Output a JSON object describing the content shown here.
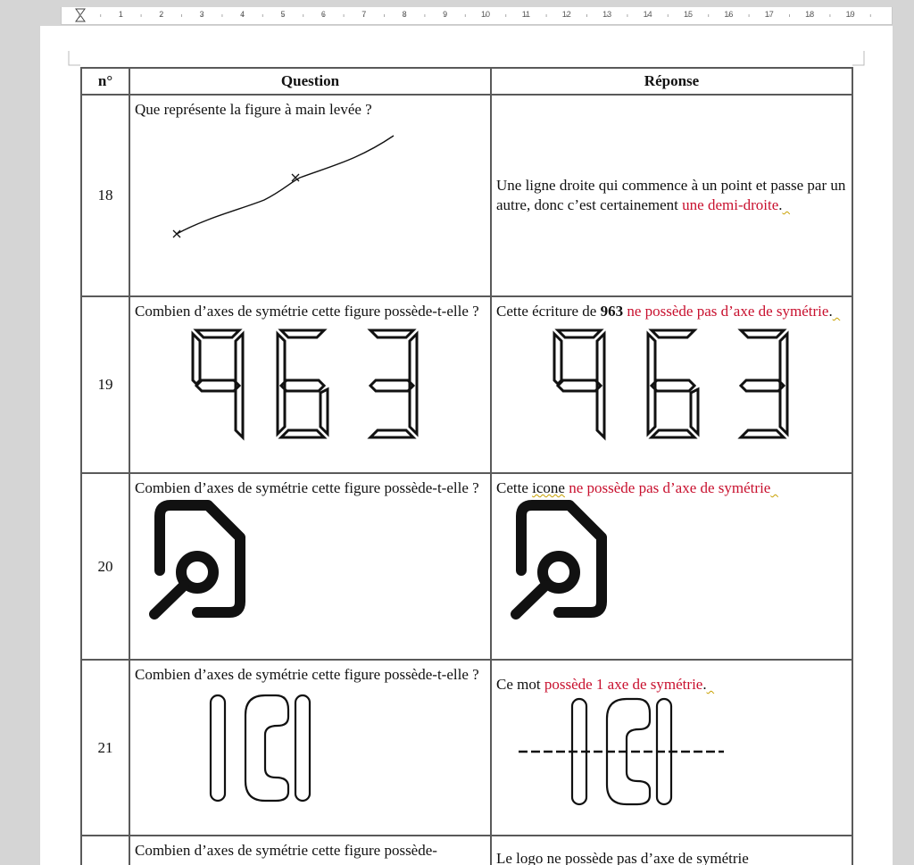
{
  "ruler": {
    "numbers": [
      "1",
      "2",
      "3",
      "4",
      "5",
      "6",
      "7",
      "8",
      "9",
      "10",
      "11",
      "12",
      "13",
      "14",
      "15",
      "16",
      "17",
      "18",
      "19"
    ]
  },
  "table": {
    "headers": {
      "num": "n°",
      "question": "Question",
      "answer": "Réponse"
    },
    "rows": [
      {
        "num": "18",
        "question": "Que représente la figure à main levée ?",
        "answer_plain": "Une ligne droite qui commence à un point et passe par un autre, donc c’est certainement ",
        "answer_red": "une demi-droite",
        "answer_end": "."
      },
      {
        "num": "19",
        "question": "Combien d’axes de symétrie cette figure possède-t-elle ?",
        "answer_plain": "Cette écriture de ",
        "answer_bold": "963",
        "answer_red": " ne possède pas d’axe de symétrie",
        "answer_end": ".",
        "digits": "963"
      },
      {
        "num": "20",
        "question": "Combien d’axes de symétrie cette figure possède-t-elle ?",
        "answer_plain": "Cette ",
        "answer_wavy": "icone",
        "answer_red": " ne possède pas d’axe de symétrie"
      },
      {
        "num": "21",
        "question": "Combien d’axes de symétrie cette figure possède-t-elle ?",
        "answer_plain": "Ce mot ",
        "answer_red": "possède 1 axe de symétrie",
        "answer_end": ".",
        "word": "ICI"
      },
      {
        "num": "",
        "question": "Combien d’axes de symétrie cette figure possède-",
        "answer_partial": "Le logo ne possède pas d’axe de symétrie"
      }
    ]
  }
}
